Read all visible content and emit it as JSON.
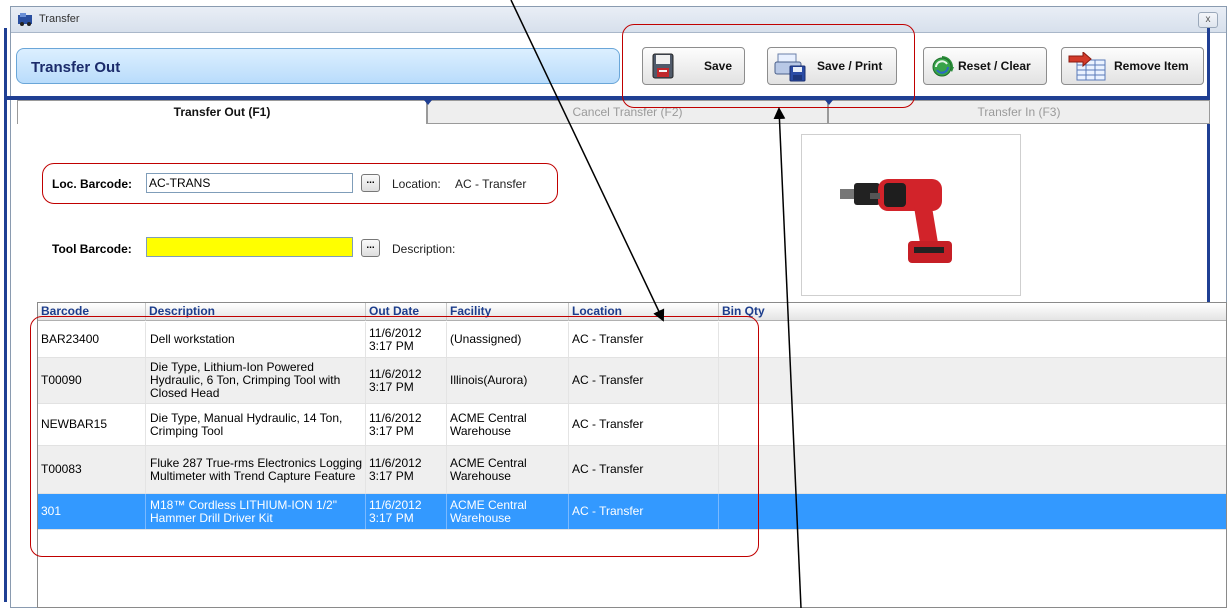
{
  "window": {
    "title": "Transfer",
    "close_label": "x"
  },
  "header": {
    "title": "Transfer Out"
  },
  "toolbar": {
    "save_label": "Save",
    "save_print_label": "Save / Print",
    "reset_label": "Reset / Clear",
    "remove_label": "Remove Item"
  },
  "tabs": [
    {
      "label": "Transfer Out (F1)",
      "active": true
    },
    {
      "label": "Cancel Transfer (F2)",
      "active": false
    },
    {
      "label": "Transfer In (F3)",
      "active": false
    }
  ],
  "form": {
    "loc_barcode_label": "Loc. Barcode:",
    "loc_barcode_value": "AC-TRANS",
    "location_label": "Location:",
    "location_value": "AC - Transfer",
    "tool_barcode_label": "Tool Barcode:",
    "tool_barcode_value": "",
    "description_label": "Description:",
    "browse_label": "..."
  },
  "grid": {
    "columns": [
      "Barcode",
      "Description",
      "Out Date",
      "Facility",
      "Location",
      "Bin Qty"
    ],
    "rows": [
      {
        "barcode": "BAR23400",
        "description": "Dell workstation",
        "out_date": "11/6/2012\n3:17 PM",
        "facility": "(Unassigned)",
        "location": "AC - Transfer",
        "bin_qty": ""
      },
      {
        "barcode": "T00090",
        "description": "Die Type, Lithium-Ion Powered Hydraulic, 6 Ton, Crimping Tool with Closed Head",
        "out_date": "11/6/2012\n3:17 PM",
        "facility": "Illinois(Aurora)",
        "location": "AC - Transfer",
        "bin_qty": ""
      },
      {
        "barcode": "NEWBAR15",
        "description": "Die Type, Manual Hydraulic, 14 Ton, Crimping Tool",
        "out_date": "11/6/2012\n3:17 PM",
        "facility": "ACME Central Warehouse",
        "location": "AC - Transfer",
        "bin_qty": ""
      },
      {
        "barcode": "T00083",
        "description": "Fluke 287 True-rms Electronics Logging Multimeter with Trend Capture Feature",
        "out_date": "11/6/2012\n3:17 PM",
        "facility": "ACME Central Warehouse",
        "location": "AC - Transfer",
        "bin_qty": ""
      },
      {
        "barcode": "301",
        "description": "M18™ Cordless LITHIUM-ION 1/2\" Hammer Drill Driver Kit",
        "out_date": "11/6/2012\n3:17 PM",
        "facility": "ACME Central Warehouse",
        "location": "AC - Transfer",
        "bin_qty": ""
      }
    ],
    "selected_row": 4
  },
  "colors": {
    "accent_blue": "#1f3f93",
    "selection": "#3399ff",
    "annotation_red": "#c00000",
    "field_highlight": "#ffff00"
  }
}
